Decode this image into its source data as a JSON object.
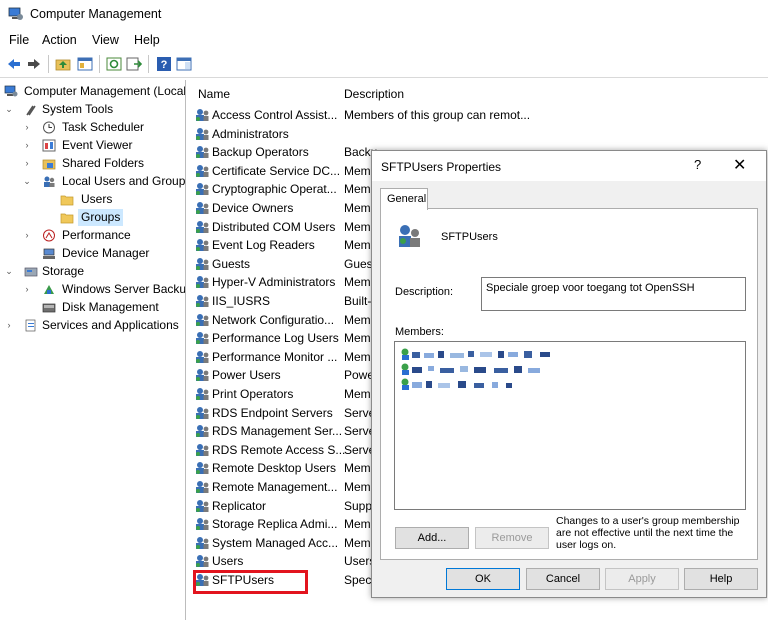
{
  "window": {
    "title": "Computer Management",
    "icon": "computer-management-icon"
  },
  "menu": [
    "File",
    "Action",
    "View",
    "Help"
  ],
  "tree": [
    {
      "label": "Computer Management (Local",
      "level": 0,
      "arrow": "",
      "icon": "computer-management-icon"
    },
    {
      "label": "System Tools",
      "level": 1,
      "arrow": "⌄",
      "icon": "tools-icon"
    },
    {
      "label": "Task Scheduler",
      "level": 2,
      "arrow": "›",
      "icon": "clock-icon"
    },
    {
      "label": "Event Viewer",
      "level": 2,
      "arrow": "›",
      "icon": "event-viewer-icon"
    },
    {
      "label": "Shared Folders",
      "level": 2,
      "arrow": "›",
      "icon": "shared-folder-icon"
    },
    {
      "label": "Local Users and Groups",
      "level": 2,
      "arrow": "⌄",
      "icon": "users-icon"
    },
    {
      "label": "Users",
      "level": 3,
      "arrow": "",
      "icon": "folder-icon"
    },
    {
      "label": "Groups",
      "level": 3,
      "arrow": "",
      "icon": "folder-icon",
      "selected": true
    },
    {
      "label": "Performance",
      "level": 2,
      "arrow": "›",
      "icon": "performance-icon"
    },
    {
      "label": "Device Manager",
      "level": 2,
      "arrow": "",
      "icon": "device-manager-icon"
    },
    {
      "label": "Storage",
      "level": 1,
      "arrow": "⌄",
      "icon": "storage-icon"
    },
    {
      "label": "Windows Server Backup",
      "level": 2,
      "arrow": "›",
      "icon": "backup-icon"
    },
    {
      "label": "Disk Management",
      "level": 2,
      "arrow": "",
      "icon": "disk-icon"
    },
    {
      "label": "Services and Applications",
      "level": 1,
      "arrow": "›",
      "icon": "services-icon"
    }
  ],
  "list": {
    "columns": [
      "Name",
      "Description"
    ],
    "rows": [
      {
        "name": "Access Control Assist...",
        "desc": "Members of this group can remot..."
      },
      {
        "name": "Administrators",
        "desc": ""
      },
      {
        "name": "Backup Operators",
        "desc": "Backu"
      },
      {
        "name": "Certificate Service DC...",
        "desc": "Mem"
      },
      {
        "name": "Cryptographic Operat...",
        "desc": "Mem"
      },
      {
        "name": "Device Owners",
        "desc": "Mem"
      },
      {
        "name": "Distributed COM Users",
        "desc": "Mem"
      },
      {
        "name": "Event Log Readers",
        "desc": "Mem"
      },
      {
        "name": "Guests",
        "desc": "Guest"
      },
      {
        "name": "Hyper-V Administrators",
        "desc": "Mem"
      },
      {
        "name": "IIS_IUSRS",
        "desc": "Built-"
      },
      {
        "name": "Network Configuratio...",
        "desc": "Mem"
      },
      {
        "name": "Performance Log Users",
        "desc": "Mem"
      },
      {
        "name": "Performance Monitor ...",
        "desc": "Mem"
      },
      {
        "name": "Power Users",
        "desc": "Powe"
      },
      {
        "name": "Print Operators",
        "desc": "Mem"
      },
      {
        "name": "RDS Endpoint Servers",
        "desc": "Serve"
      },
      {
        "name": "RDS Management Ser...",
        "desc": "Serve"
      },
      {
        "name": "RDS Remote Access S...",
        "desc": "Serve"
      },
      {
        "name": "Remote Desktop Users",
        "desc": "Mem"
      },
      {
        "name": "Remote Management...",
        "desc": "Mem"
      },
      {
        "name": "Replicator",
        "desc": "Supp"
      },
      {
        "name": "Storage Replica Admi...",
        "desc": "Mem"
      },
      {
        "name": "System Managed Acc...",
        "desc": "Mem"
      },
      {
        "name": "Users",
        "desc": "Users"
      },
      {
        "name": "SFTPUsers",
        "desc": "Speci",
        "highlighted": true
      }
    ]
  },
  "dialog": {
    "title": "SFTPUsers Properties",
    "help": "?",
    "close": "✕",
    "tab": "General",
    "group_name": "SFTPUsers",
    "description_label": "Description:",
    "description_value": "Speciale groep voor toegang tot OpenSSH",
    "members_label": "Members:",
    "add_button": "Add...",
    "remove_button": "Remove",
    "note": "Changes to a user's group membership are not effective until the next time the user logs on.",
    "ok_button": "OK",
    "cancel_button": "Cancel",
    "apply_button": "Apply",
    "help_button": "Help"
  },
  "colors": {
    "selection": "#cce8ff",
    "highlight_box": "#e2141e",
    "accent": "#0078d7"
  }
}
